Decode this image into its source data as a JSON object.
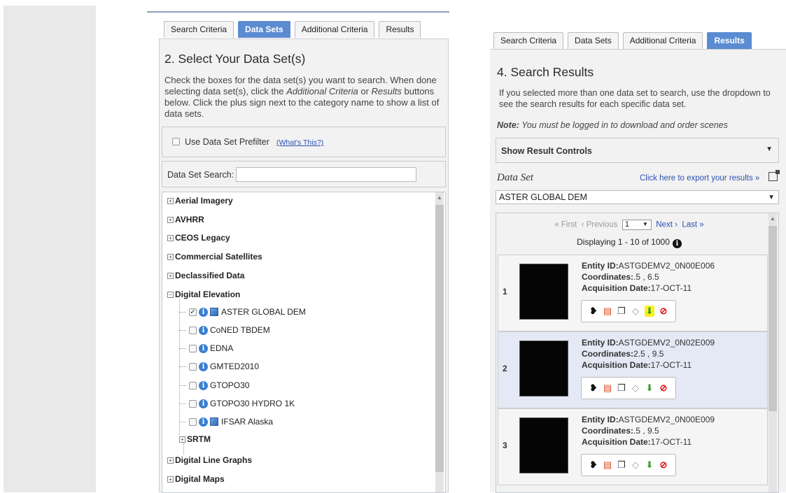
{
  "panel1": {
    "tabs": [
      {
        "label": "Search Criteria",
        "active": false
      },
      {
        "label": "Data Sets",
        "active": true
      },
      {
        "label": "Additional Criteria",
        "active": false
      },
      {
        "label": "Results",
        "active": false
      }
    ],
    "title": "2. Select Your Data Set(s)",
    "desc_parts": [
      "Check the boxes for the data set(s) you want to search. When done selecting data set(s), click the ",
      "Additional Criteria",
      " or ",
      "Results",
      " buttons below. Click the plus sign next to the category name to show a list of data sets."
    ],
    "prefilter_label": "Use Data Set Prefilter",
    "prefilter_link": "(What's This?)",
    "search_label": "Data Set Search:",
    "search_value": "",
    "categories_top": [
      "Aerial Imagery",
      "AVHRR",
      "CEOS Legacy",
      "Commercial Satellites",
      "Declassified Data",
      "Digital Elevation"
    ],
    "datasets": [
      {
        "name": "ASTER GLOBAL DEM",
        "checked": true,
        "map_icon": true
      },
      {
        "name": "CoNED TBDEM",
        "checked": false,
        "map_icon": false
      },
      {
        "name": "EDNA",
        "checked": false,
        "map_icon": false
      },
      {
        "name": "GMTED2010",
        "checked": false,
        "map_icon": false
      },
      {
        "name": "GTOPO30",
        "checked": false,
        "map_icon": false
      },
      {
        "name": "GTOPO30 HYDRO 1K",
        "checked": false,
        "map_icon": false
      },
      {
        "name": "IFSAR Alaska",
        "checked": false,
        "map_icon": true
      }
    ],
    "subcategory": "SRTM",
    "categories_bottom": [
      "Digital Line Graphs",
      "Digital Maps"
    ]
  },
  "panel2": {
    "tabs": [
      {
        "label": "Search Criteria",
        "active": false
      },
      {
        "label": "Data Sets",
        "active": false
      },
      {
        "label": "Additional Criteria",
        "active": false
      },
      {
        "label": "Results",
        "active": true
      }
    ],
    "title": "4. Search Results",
    "desc": "If you selected more than one data set to search, use the dropdown to see the search results for each specific data set.",
    "note_label": "Note:",
    "note_text": "You must be logged in to download and order scenes",
    "result_controls": "Show Result Controls",
    "dataset_label": "Data Set",
    "export_link": "Click here to export your results »",
    "dataset_selected": "ASTER GLOBAL DEM",
    "pager": {
      "first": "« First",
      "previous": "‹ Previous",
      "page": "1",
      "next": "Next ›",
      "last": "Last »"
    },
    "displaying": "Displaying 1 - 10 of 1000",
    "results": [
      {
        "num": "1",
        "entity": "ASTGDEMV2_0N00E006",
        "coordinates": ".5 , 6.5",
        "acq_date": "17-OCT-11",
        "selected": false,
        "download_highlight": true
      },
      {
        "num": "2",
        "entity": "ASTGDEMV2_0N02E009",
        "coordinates": "2.5 , 9.5",
        "acq_date": "17-OCT-11",
        "selected": true,
        "download_highlight": false
      },
      {
        "num": "3",
        "entity": "ASTGDEMV2_0N00E009",
        "coordinates": ".5 , 9.5",
        "acq_date": "17-OCT-11",
        "selected": false,
        "download_highlight": false
      }
    ],
    "entity_label": "Entity ID:",
    "coord_label": "Coordinates:",
    "acq_label": "Acquisition Date:"
  }
}
